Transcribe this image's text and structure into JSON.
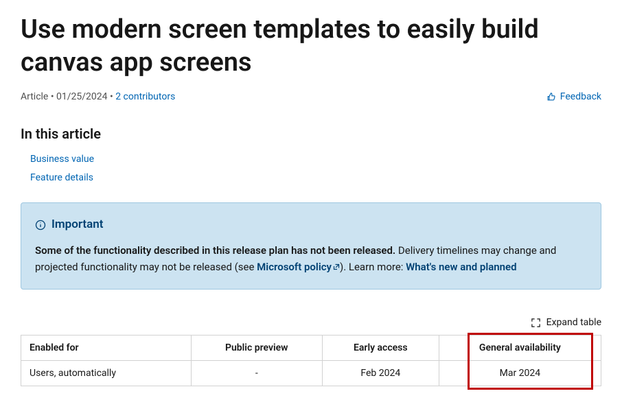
{
  "title": "Use modern screen templates to easily build canvas app screens",
  "meta": {
    "type": "Article",
    "date": "01/25/2024",
    "contributors": "2 contributors"
  },
  "feedback_label": "Feedback",
  "toc": {
    "heading": "In this article",
    "items": [
      "Business value",
      "Feature details"
    ]
  },
  "alert": {
    "title": "Important",
    "bold_text": "Some of the functionality described in this release plan has not been released.",
    "body_text_1": " Delivery timelines may change and projected functionality may not be released (see ",
    "policy_link": "Microsoft policy",
    "body_text_2": "). Learn more: ",
    "whats_new_link": "What's new and planned"
  },
  "expand_label": "Expand table",
  "table": {
    "headers": [
      "Enabled for",
      "Public preview",
      "Early access",
      "General availability"
    ],
    "row": [
      "Users, automatically",
      "-",
      "Feb 2024",
      "Mar 2024"
    ]
  }
}
